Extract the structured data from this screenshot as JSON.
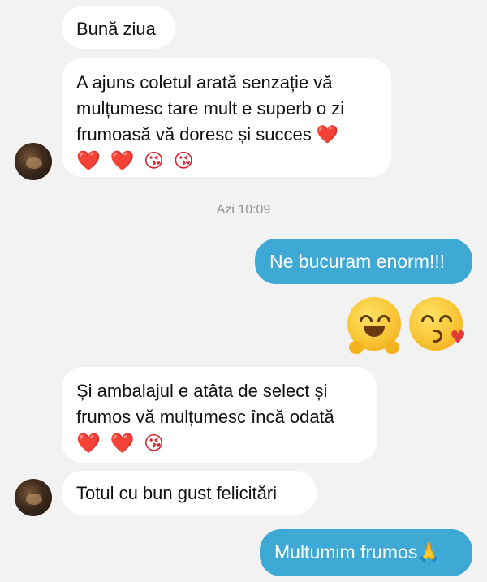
{
  "messages": {
    "m1": {
      "text": "Bună ziua"
    },
    "m2": {
      "text": "A ajuns coletul arată senzație vă\nmulțumesc tare mult e superb o zi\nfrumoasă vă doresc și succes ❤️",
      "emoji_line": "❤️ ❤️ 😘 😘"
    },
    "timestamp": "Azi 10:09",
    "m3": {
      "text": "Ne bucuram enorm!!!"
    },
    "m4": {
      "emojis": [
        "hugging-face-icon",
        "face-blowing-kiss-icon"
      ]
    },
    "m5": {
      "text": "Și ambalajul e atâta de select și\nfrumos vă mulțumesc încă odată",
      "emoji_line": "❤️ ❤️ 😘"
    },
    "m6": {
      "text": "Totul cu bun gust felicitări"
    },
    "m7": {
      "text": "Multumim frumos🙏"
    }
  },
  "colors": {
    "background": "#f2f2f2",
    "incoming_bubble": "#ffffff",
    "outgoing_bubble": "#3fa9d6"
  }
}
